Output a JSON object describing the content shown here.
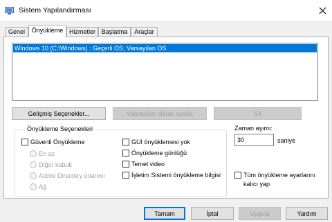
{
  "window": {
    "title": "Sistem Yapılandırması",
    "icon": "msconfig-icon"
  },
  "tabs": [
    {
      "label": "Genel",
      "active": false
    },
    {
      "label": "Önyükleme",
      "active": true
    },
    {
      "label": "Hizmetler",
      "active": false
    },
    {
      "label": "Başlatma",
      "active": false
    },
    {
      "label": "Araçlar",
      "active": false
    }
  ],
  "boot_list": {
    "items": [
      "Windows 10 (C:\\Windows) : Geçerli OS; Varsayılan OS"
    ],
    "selected_index": 0
  },
  "list_buttons": {
    "advanced": "Gelişmiş Seçenekler...",
    "set_default": "Varsayılan olarak ayarla",
    "delete": "Sil"
  },
  "boot_options": {
    "title": "Önyükleme Seçenekleri",
    "safe_boot": "Güvenli Önyükleme",
    "radios": [
      "En az",
      "Diğer kabuk",
      "Active Directory onarımı",
      "Ağ"
    ],
    "no_gui": "GUI önyüklemesi yok",
    "boot_log": "Önyükleme günlüğü",
    "base_video": "Temel video",
    "os_info": "İşletim Sistemi önyükleme bilgisi"
  },
  "timeout": {
    "label": "Zaman aşımı:",
    "value": "30",
    "unit": "saniye"
  },
  "permanent": {
    "line1": "Tüm önyükleme ayarlarını",
    "line2": "kalıcı yap"
  },
  "dialog_buttons": {
    "ok": "Tamam",
    "cancel": "İptal",
    "apply": "Uygula",
    "help": "Yardım"
  },
  "colors": {
    "selection": "#0078d7",
    "window_bg": "#f0f0f0"
  }
}
